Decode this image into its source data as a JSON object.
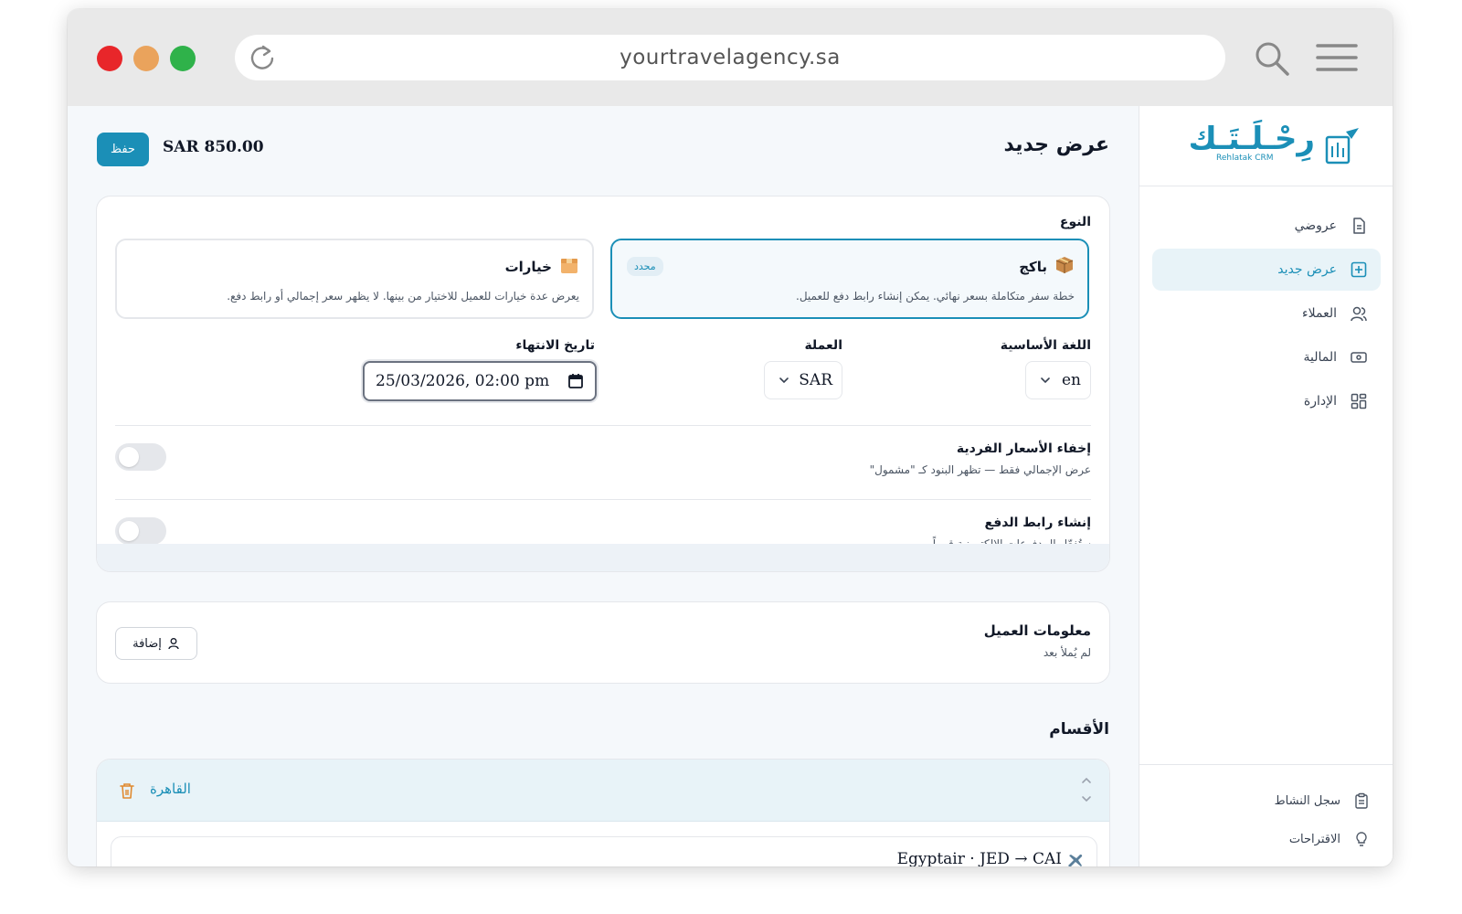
{
  "browser": {
    "url": "yourtravelagency.sa"
  },
  "sidebar": {
    "logo_text": "رِحْـلَـتَـك",
    "logo_sub": "Rehlatak CRM",
    "items": [
      {
        "label": "عروضي",
        "icon": "document-icon"
      },
      {
        "label": "عرض جديد",
        "icon": "plus-square-icon",
        "active": true
      },
      {
        "label": "العملاء",
        "icon": "users-icon"
      },
      {
        "label": "المالية",
        "icon": "money-icon"
      },
      {
        "label": "الإدارة",
        "icon": "grid-icon"
      }
    ],
    "bottom_items": [
      {
        "label": "سجل النشاط",
        "icon": "clipboard-icon"
      },
      {
        "label": "الاقتراحات",
        "icon": "lightbulb-icon"
      }
    ]
  },
  "header": {
    "title": "عرض جديد",
    "total": "SAR 850.00",
    "save_label": "حفظ"
  },
  "offer_form": {
    "type_label": "النوع",
    "types": [
      {
        "title": "باكج",
        "desc": "خطة سفر متكاملة بسعر نهائي. يمكن إنشاء رابط دفع للعميل.",
        "badge": "محدد",
        "icon": "package-icon",
        "selected": true
      },
      {
        "title": "خيارات",
        "desc": "يعرض عدة خيارات للعميل للاختيار من بينها. لا يظهر سعر إجمالي أو رابط دفع.",
        "icon": "box-icon",
        "selected": false
      }
    ],
    "language_label": "اللغة الأساسية",
    "language_value": "en",
    "currency_label": "العملة",
    "currency_value": "SAR",
    "expiry_label": "تاريخ الانتهاء",
    "expiry_value": "25/03/2026, 02:00 pm",
    "hide_prices": {
      "title": "إخفاء الأسعار الفردية",
      "desc": "عرض الإجمالي فقط — تظهر البنود كـ \"مشمول\"",
      "enabled": false
    },
    "payment_link": {
      "title": "إنشاء رابط الدفع",
      "desc": "ستُفعّل المدفوعات الإلكترونية قريباً.",
      "enabled": false
    }
  },
  "client_info": {
    "title": "معلومات العميل",
    "subtitle": "لم يُملأ بعد",
    "add_label": "إضافة"
  },
  "sections": {
    "title": "الأقسام",
    "items": [
      {
        "name": "القاهرة",
        "flight": "Egyptair · JED → CAI"
      }
    ]
  },
  "colors": {
    "accent": "#1b8fb7",
    "accent_light": "#e8f3f8"
  }
}
